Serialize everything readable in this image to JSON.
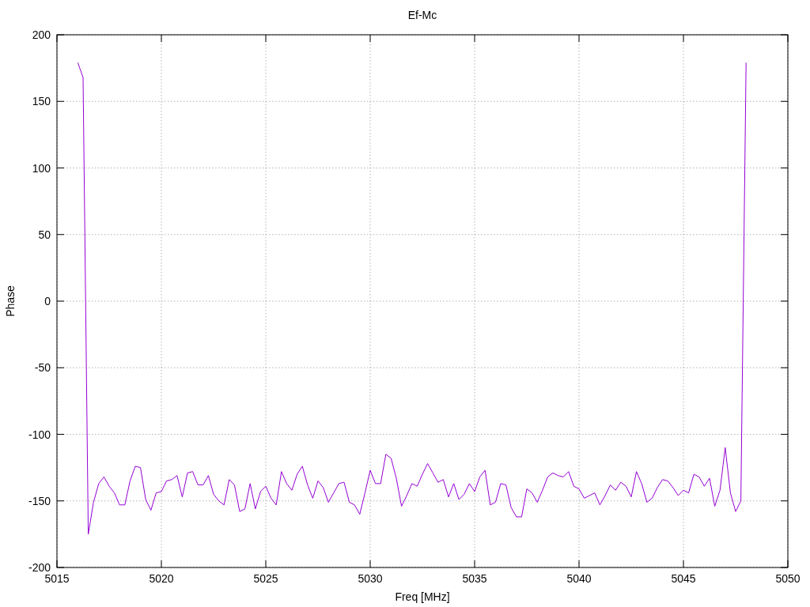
{
  "plot": {
    "chart_data": {
      "type": "line",
      "title": "Ef-Mc",
      "xlabel": "Freq [MHz]",
      "ylabel": "Phase",
      "xlim": [
        5015,
        5050
      ],
      "ylim": [
        -200,
        200
      ],
      "xticks": [
        5015,
        5020,
        5025,
        5030,
        5035,
        5040,
        5045,
        5050
      ],
      "yticks": [
        -200,
        -150,
        -100,
        -50,
        0,
        50,
        100,
        150,
        200
      ],
      "x": [
        5016,
        5016.25,
        5016.5,
        5016.75,
        5017,
        5017.25,
        5017.5,
        5017.75,
        5018,
        5018.25,
        5018.5,
        5018.75,
        5019,
        5019.25,
        5019.5,
        5019.75,
        5020,
        5020.25,
        5020.5,
        5020.75,
        5021,
        5021.25,
        5021.5,
        5021.75,
        5022,
        5022.25,
        5022.5,
        5022.75,
        5023,
        5023.25,
        5023.5,
        5023.75,
        5024,
        5024.25,
        5024.5,
        5024.75,
        5025,
        5025.25,
        5025.5,
        5025.75,
        5026,
        5026.25,
        5026.5,
        5026.75,
        5027,
        5027.25,
        5027.5,
        5027.75,
        5028,
        5028.25,
        5028.5,
        5028.75,
        5029,
        5029.25,
        5029.5,
        5029.75,
        5030,
        5030.25,
        5030.5,
        5030.75,
        5031,
        5031.25,
        5031.5,
        5031.75,
        5032,
        5032.25,
        5032.5,
        5032.75,
        5033,
        5033.25,
        5033.5,
        5033.75,
        5034,
        5034.25,
        5034.5,
        5034.75,
        5035,
        5035.25,
        5035.5,
        5035.75,
        5036,
        5036.25,
        5036.5,
        5036.75,
        5037,
        5037.25,
        5037.5,
        5037.75,
        5038,
        5038.25,
        5038.5,
        5038.75,
        5039,
        5039.25,
        5039.5,
        5039.75,
        5040,
        5040.25,
        5040.5,
        5040.75,
        5041,
        5041.25,
        5041.5,
        5041.75,
        5042,
        5042.25,
        5042.5,
        5042.75,
        5043,
        5043.25,
        5043.5,
        5043.75,
        5044,
        5044.25,
        5044.5,
        5044.75,
        5045,
        5045.25,
        5045.5,
        5045.75,
        5046,
        5046.25,
        5046.5,
        5046.75,
        5047,
        5047.25,
        5047.5,
        5047.75,
        5048
      ],
      "grid": true,
      "series": [
        {
          "color": "#9400d3",
          "values": [
            179,
            168,
            -175,
            -151,
            -137,
            -132,
            -139,
            -144,
            -153,
            -153,
            -135,
            -124,
            -125,
            -149,
            -157,
            -144,
            -143,
            -135,
            -134,
            -131,
            -147,
            -129,
            -128,
            -138,
            -138,
            -131,
            -145,
            -150,
            -153,
            -134,
            -138,
            -158,
            -156,
            -137,
            -156,
            -143,
            -139,
            -148,
            -153,
            -128,
            -137,
            -142,
            -130,
            -124,
            -138,
            -148,
            -135,
            -140,
            -151,
            -144,
            -137,
            -136,
            -151,
            -153,
            -160,
            -144,
            -127,
            -137,
            -137,
            -115,
            -118,
            -133,
            -154,
            -146,
            -137,
            -139,
            -130,
            -122,
            -129,
            -136,
            -134,
            -147,
            -137,
            -149,
            -145,
            -137,
            -143,
            -132,
            -127,
            -153,
            -151,
            -137,
            -138,
            -155,
            -162,
            -162,
            -141,
            -144,
            -151,
            -142,
            -132,
            -129,
            -131,
            -132,
            -128,
            -139,
            -141,
            -148,
            -146,
            -144,
            -153,
            -146,
            -138,
            -142,
            -136,
            -139,
            -147,
            -128,
            -137,
            -151,
            -148,
            -140,
            -134,
            -135,
            -140,
            -146,
            -142,
            -144,
            -130,
            -132,
            -139,
            -133,
            -154,
            -142,
            -110,
            -144,
            -158,
            -150,
            179
          ]
        }
      ]
    }
  }
}
